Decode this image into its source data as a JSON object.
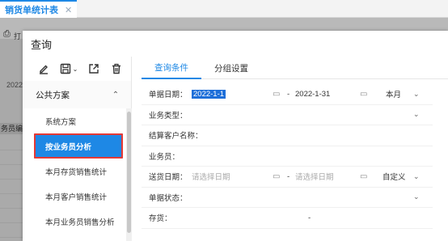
{
  "app": {
    "tab_label": "销货单统计表",
    "tab_close": "✕",
    "print_text": "打",
    "year_text": "2022",
    "cell_text": "务员编"
  },
  "dialog": {
    "title": "查询",
    "scheme_group": "公共方案",
    "scheme_items": [
      "系统方案",
      "按业务员分析",
      "本月存货销售统计",
      "本月客户销售统计",
      "本月业务员销售分析"
    ],
    "active_scheme_index": 1,
    "tabs": [
      "查询条件",
      "分组设置"
    ],
    "active_tab_index": 0
  },
  "form": {
    "date_label": "单据日期：",
    "date_start": "2022-1-1",
    "date_sep": "-",
    "date_end": "2022-1-31",
    "date_range_option": "本月",
    "biz_type_label": "业务类型：",
    "customer_label": "结算客户名称：",
    "salesman_label": "业务员：",
    "delivery_label": "送货日期：",
    "delivery_start_placeholder": "请选择日期",
    "delivery_sep": "-",
    "delivery_end_placeholder": "请选择日期",
    "delivery_option": "自定义",
    "status_label": "单据状态：",
    "stock_label": "存货：",
    "stock_sep": "-"
  },
  "colors": {
    "accent": "#1e88e5",
    "highlight_border": "#e53935"
  }
}
